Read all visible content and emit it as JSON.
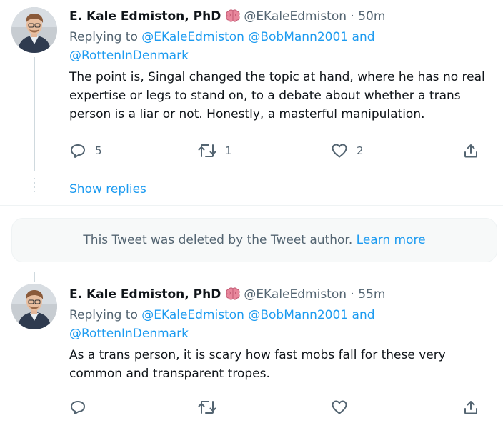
{
  "tweets": [
    {
      "name": "E. Kale Edmiston, PhD",
      "handle": "@EKaleEdmiston",
      "separator": "·",
      "time": "50m",
      "replying_prefix": "Replying to",
      "mentions": [
        "@EKaleEdmiston",
        "@BobMann2001",
        "and",
        "@RottenInDenmark"
      ],
      "text": "The point is, Singal changed the topic at hand, where he has no real expertise or legs to stand on, to a debate about whether a trans person is a liar or not. Honestly, a masterful manipulation.",
      "reply_count": "5",
      "retweet_count": "1",
      "like_count": "2"
    },
    {
      "name": "E. Kale Edmiston, PhD",
      "handle": "@EKaleEdmiston",
      "separator": "·",
      "time": "55m",
      "replying_prefix": "Replying to",
      "mentions": [
        "@EKaleEdmiston",
        "@BobMann2001",
        "and",
        "@RottenInDenmark"
      ],
      "text": "As a trans person, it is scary how fast mobs fall for these very common and transparent tropes.",
      "reply_count": "",
      "retweet_count": "",
      "like_count": ""
    }
  ],
  "show_replies": "Show replies",
  "deleted_notice": {
    "text": "This Tweet was deleted by the Tweet author.",
    "link": "Learn more"
  },
  "icons": {
    "emoji": "brain-emoji",
    "reply": "reply-icon",
    "retweet": "retweet-icon",
    "like": "heart-icon",
    "share": "share-icon"
  },
  "colors": {
    "link": "#1d9bf0",
    "secondary_text": "#536471",
    "brain": "#e8879c"
  }
}
